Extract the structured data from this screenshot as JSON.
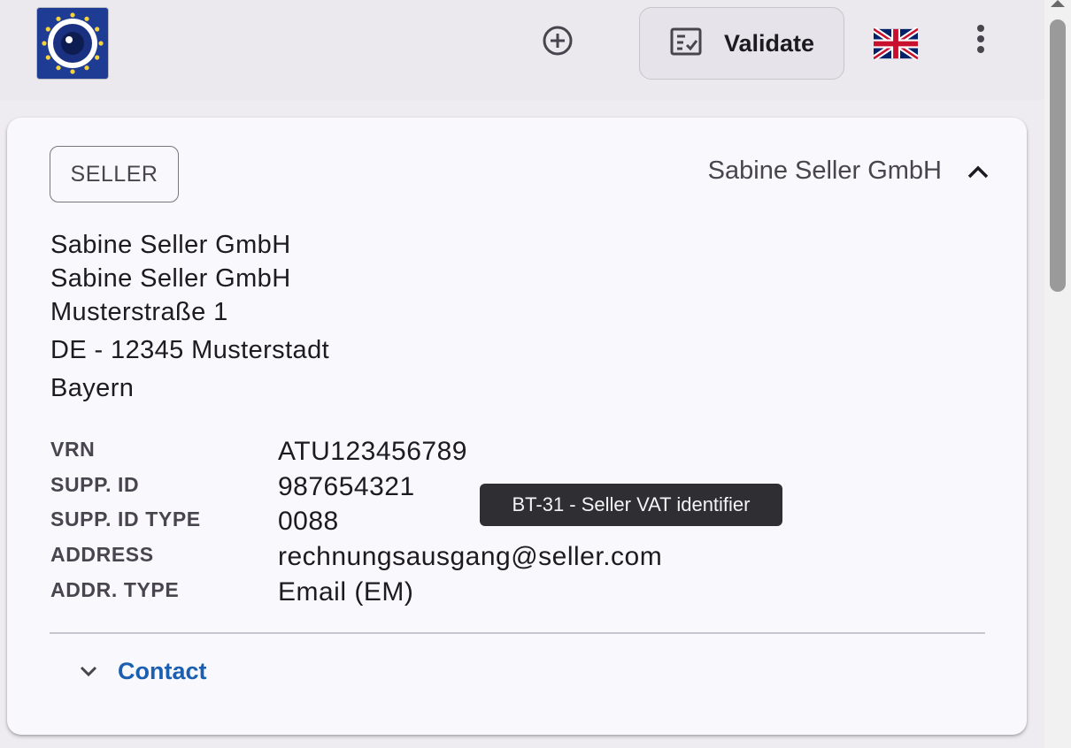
{
  "toolbar": {
    "logo_icon": "eu-logo-icon",
    "add_icon": "add-circle-icon",
    "validate_label": "Validate",
    "validate_icon": "checklist-icon",
    "language_icon": "uk-flag-icon",
    "more_icon": "more-vert-icon"
  },
  "card": {
    "role_chip": "SELLER",
    "header_name": "Sabine Seller GmbH",
    "collapse_icon": "chevron-up-icon",
    "address_lines": [
      "Sabine Seller GmbH",
      "Sabine Seller GmbH",
      "Musterstraße 1",
      "DE - 12345 Musterstadt",
      "Bayern"
    ],
    "details": [
      {
        "label": "VRN",
        "value": "ATU123456789"
      },
      {
        "label": "SUPP. ID",
        "value": "987654321"
      },
      {
        "label": "SUPP. ID TYPE",
        "value": "0088"
      },
      {
        "label": "ADDRESS",
        "value": "rechnungsausgang@seller.com"
      },
      {
        "label": "ADDR. TYPE",
        "value": "Email (EM)"
      }
    ],
    "tooltip": "BT-31 - Seller VAT identifier",
    "contact_label": "Contact",
    "contact_icon": "chevron-down-icon"
  },
  "colors": {
    "topbar": "#ebe9ed",
    "card": "#f9f8fd",
    "link": "#1a5fb0",
    "tooltip": "#2f2f33"
  }
}
